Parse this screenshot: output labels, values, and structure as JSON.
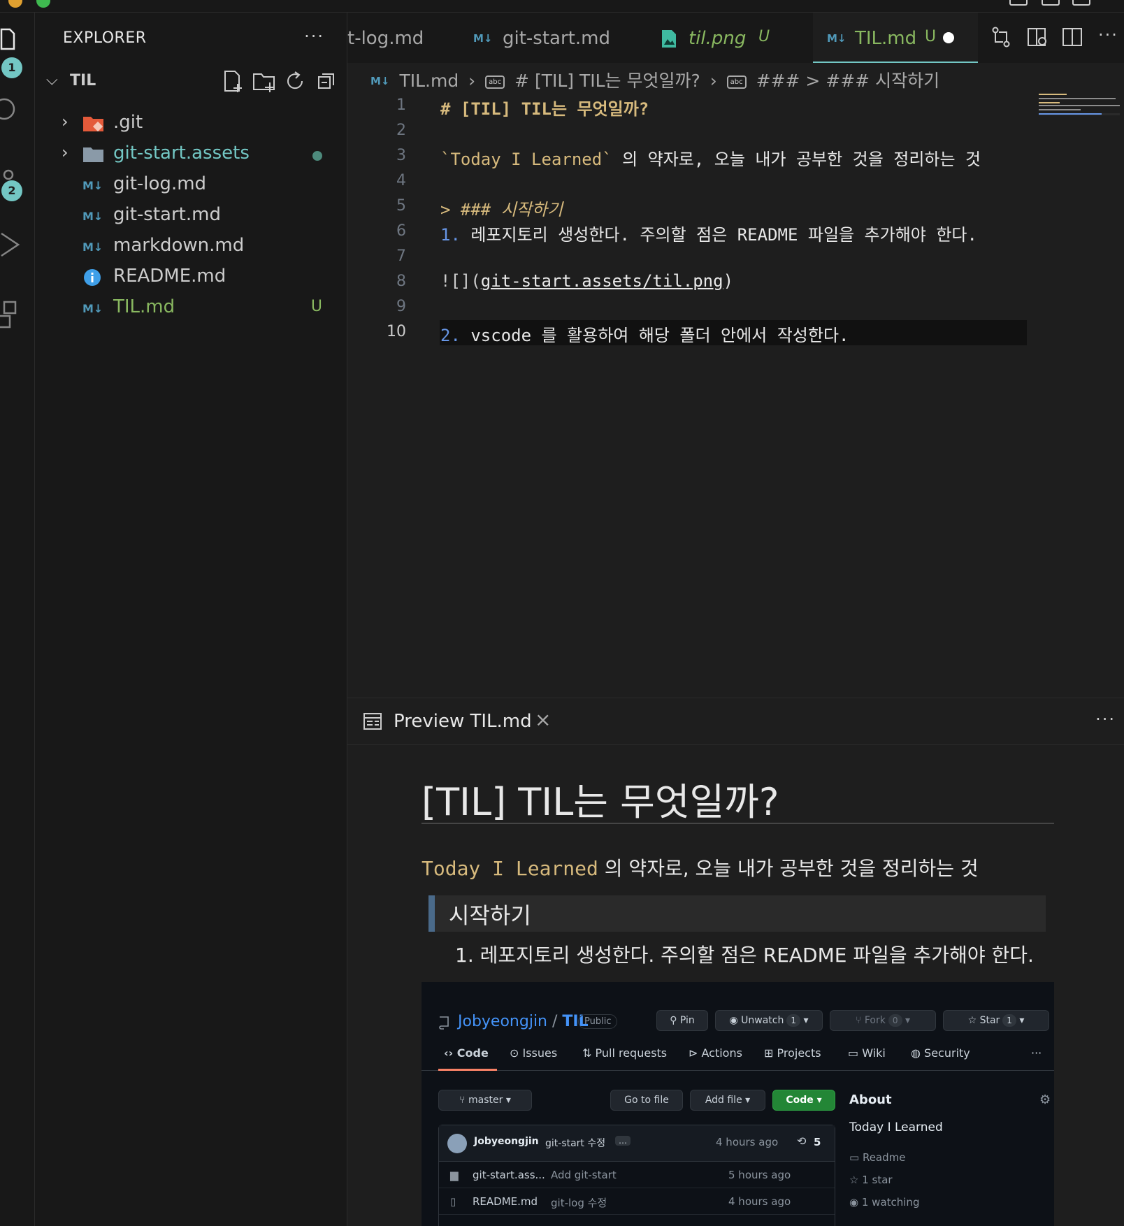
{
  "sidebar": {
    "title": "EXPLORER",
    "more": "···",
    "section": "TIL",
    "items": [
      {
        "name": ".git",
        "kind": "folder-git",
        "deco": ""
      },
      {
        "name": "git-start.assets",
        "kind": "folder",
        "deco": "dot"
      },
      {
        "name": "git-log.md",
        "kind": "md",
        "deco": ""
      },
      {
        "name": "git-start.md",
        "kind": "md",
        "deco": ""
      },
      {
        "name": "markdown.md",
        "kind": "md",
        "deco": ""
      },
      {
        "name": "README.md",
        "kind": "info",
        "deco": ""
      },
      {
        "name": "TIL.md",
        "kind": "md",
        "deco": "U"
      }
    ]
  },
  "activity": {
    "badge1": "1",
    "badge2": "2"
  },
  "tabs": {
    "t1": "t-log.md",
    "t2": "git-start.md",
    "t3": "til.png",
    "t3_mod": "U",
    "t4": "TIL.md",
    "t4_mod": "U",
    "md_icon": "M↓"
  },
  "breadcrumb": {
    "file": "TIL.md",
    "h1": "# [TIL] TIL는 무엇일까?",
    "h3": "### > ### 시작하기"
  },
  "editor": {
    "line_numbers": [
      "1",
      "2",
      "3",
      "4",
      "5",
      "6",
      "7",
      "8",
      "9",
      "10"
    ],
    "l1": "# [TIL] TIL는 무엇일까?",
    "l3_code": "`Today I Learned`",
    "l3_rest": " 의 약자로, 오늘 내가 공부한 것을 정리하는 것",
    "l5_gt": ">",
    "l5_rest": " ### 시작하기",
    "l6_num": "1.",
    "l6_rest": " 레포지토리 생성한다. 주의할 점은 README 파일을 추가해야 한다.",
    "l8_a": "![](",
    "l8_link": "git-start.assets/til.png",
    "l8_b": ")",
    "l10_num": "2.",
    "l10_rest": " vscode 를 활용하여 해당 폴더 안에서 작성한다."
  },
  "preview": {
    "tab_label": "Preview TIL.md",
    "close": "×",
    "more": "···",
    "h1": "[TIL] TIL는 무엇일까?",
    "para_code": "Today I Learned",
    "para_rest": " 의 약자로, 오늘 내가 공부한 것을 정리하는 것",
    "quote": "시작하기",
    "li": "1. 레포지토리 생성한다. 주의할 점은 README 파일을 추가해야 한다."
  },
  "github": {
    "owner": "Jobyeongjin",
    "sep": " / ",
    "repo": "TIL",
    "visibility": "Public",
    "pin": "Pin",
    "unwatch": "Unwatch",
    "unwatch_count": "1",
    "fork": "Fork",
    "fork_count": "0",
    "star": "Star",
    "star_count": "1",
    "nav": [
      "Code",
      "Issues",
      "Pull requests",
      "Actions",
      "Projects",
      "Wiki",
      "Security"
    ],
    "nav_more": "···",
    "branch": "master",
    "goto": "Go to file",
    "addfile": "Add file",
    "code_btn": "Code",
    "commit_user": "Jobyeongjin",
    "commit_msg": "git-start 수정",
    "commit_dots": "…",
    "commit_time": "4 hours ago",
    "commit_count": "5",
    "rows": [
      {
        "name": "git-start.ass...",
        "msg": "Add git-start",
        "time": "5 hours ago"
      },
      {
        "name": "README.md",
        "msg": "git-log 수정",
        "time": "4 hours ago"
      }
    ],
    "about": "About",
    "about_desc": "Today I Learned",
    "readme": "Readme",
    "stars": "1 star",
    "watching": "1 watching"
  },
  "colors": {
    "accent_teal": "#73c7c4",
    "md_blue": "#519aba",
    "untracked_green": "#89b860",
    "heading_yellow": "#d7ba7d",
    "gh_green": "#238636"
  }
}
